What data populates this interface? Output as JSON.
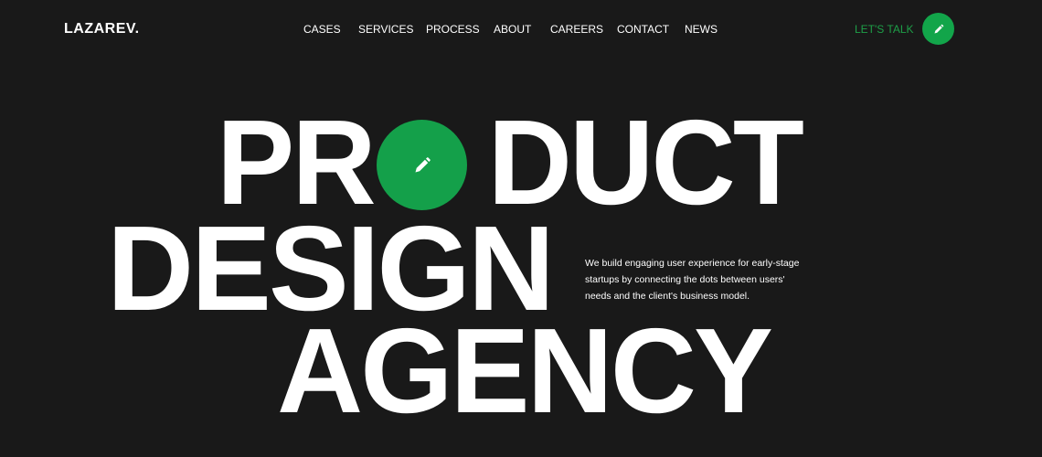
{
  "header": {
    "logo": "LAZAREV.",
    "nav": [
      "CASES",
      "SERVICES",
      "PROCESS",
      "ABOUT",
      "CAREERS",
      "CONTACT",
      "NEWS"
    ],
    "cta_label": "LET'S TALK",
    "cta_icon": "pencil-icon"
  },
  "hero": {
    "line1_a": "PR",
    "line1_b": "DUCT",
    "line2": "DESIGN",
    "line3": "AGENCY",
    "circle_icon": "pencil-icon",
    "description": "We build engaging user experience for early-stage startups by connecting the dots between users' needs and the client's business model."
  },
  "colors": {
    "background": "#191919",
    "accent": "#12a54a",
    "text": "#ffffff"
  }
}
